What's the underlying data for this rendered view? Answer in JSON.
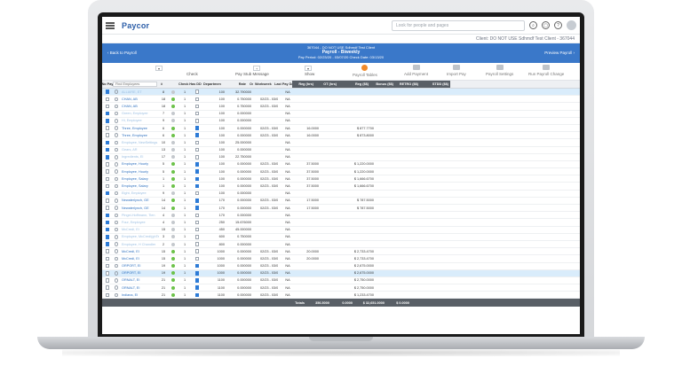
{
  "app": {
    "logo": "Paycor",
    "search_placeholder": "Look for people and pages"
  },
  "client_label": "Client: DO NOT USE Sdhmdf Test Client - 367044",
  "header": {
    "back_label": "Back to Payroll",
    "preview_label": "Preview Payroll",
    "line1": "367044 - DO NOT USE Sdhmdf Test Client",
    "line2": "Payroll - Biweekly",
    "line3": "Pay Period: 02/23/20 - 03/07/20    Check Date: 03/13/20"
  },
  "toolbar": {
    "check_label": "Check",
    "pay_stub_label": "Pay Stub Message",
    "show_label": "Show",
    "active_label": "Payroll Tables",
    "tools": [
      "Add Payment",
      "Import Pay",
      "Payroll Settings",
      "Run Payroll Change"
    ]
  },
  "columns": {
    "no_pay": "No Pay",
    "search": "Find Employees",
    "num": "#",
    "check": "Check",
    "has_dd": "Has DD",
    "department": "Department",
    "rate": "Rate",
    "ovr": "Ovrd",
    "workweek": "Workweek",
    "last_pay": "Last Pay Date",
    "reg_hrs": "Reg (hrs)",
    "ot_hrs": "OT (hrs)",
    "reg_amt": "Reg ($$)",
    "bonus": "Bonus ($$)",
    "retro": "RETRO ($$)",
    "std": "STDD ($$)"
  },
  "rows": [
    {
      "name": "ALLAIRE, ET",
      "num": "8",
      "check": "1",
      "dept": "100",
      "rate": "32.790000",
      "date": "",
      "lpd": "NA",
      "reg": "",
      "regamt": "",
      "noPay": true,
      "dot": "gray",
      "sel": true,
      "dis": true
    },
    {
      "name": "CHAN, AB",
      "num": "18",
      "check": "1",
      "dept": "100",
      "rate": "0.750000",
      "date": "02/23 - 03/01",
      "lpd": "NA",
      "reg": "",
      "regamt": "",
      "dot": "green"
    },
    {
      "name": "CHAN, AB",
      "num": "18",
      "check": "1",
      "dept": "100",
      "rate": "0.750000",
      "date": "02/23 - 03/08",
      "lpd": "NA",
      "reg": "",
      "regamt": "",
      "dot": "green"
    },
    {
      "name": "Green, Employee",
      "num": "7",
      "check": "1",
      "dept": "100",
      "rate": "0.000000",
      "date": "",
      "lpd": "NA",
      "reg": "",
      "regamt": "",
      "noPay": true,
      "dot": "gray",
      "dis": true
    },
    {
      "name": "Hi, Employee",
      "num": "9",
      "check": "1",
      "dept": "100",
      "rate": "0.000000",
      "date": "",
      "lpd": "NA",
      "reg": "",
      "regamt": "",
      "noPay": true,
      "dot": "gray",
      "dis": true
    },
    {
      "name": "Three, Employee",
      "num": "6",
      "check": "1",
      "dept": "100",
      "rate": "0.000000",
      "date": "02/23 - 03/01",
      "lpd": "NA",
      "reg": "16.0000",
      "regamt": "$ 877.7700",
      "dot": "green",
      "dd": true,
      "bar": true
    },
    {
      "name": "Three, Employee",
      "num": "6",
      "check": "1",
      "dept": "100",
      "rate": "0.000000",
      "date": "02/23 - 03/08",
      "lpd": "NA",
      "reg": "16.0000",
      "regamt": "$ 873.8000",
      "dot": "green",
      "dd": true,
      "bar": true
    },
    {
      "name": "Employee, NewSettings",
      "num": "10",
      "check": "1",
      "dept": "100",
      "rate": "25.000000",
      "date": "",
      "lpd": "NA",
      "reg": "",
      "regamt": "",
      "noPay": true,
      "dot": "gray",
      "dis": true
    },
    {
      "name": "Gears, AR",
      "num": "13",
      "check": "1",
      "dept": "100",
      "rate": "0.000000",
      "date": "",
      "lpd": "NA",
      "reg": "",
      "regamt": "",
      "noPay": true,
      "dot": "gray",
      "dis": true
    },
    {
      "name": "Ingredients, EI",
      "num": "17",
      "check": "1",
      "dept": "100",
      "rate": "22.750000",
      "date": "",
      "lpd": "NA",
      "reg": "",
      "regamt": "",
      "noPay": true,
      "dot": "gray",
      "dis": true
    },
    {
      "name": "Employee, Hourly",
      "num": "5",
      "check": "1",
      "dept": "100",
      "rate": "0.000000",
      "date": "02/23 - 03/01",
      "lpd": "NA",
      "reg": "37.5000",
      "regamt": "$ 1,220.0000",
      "dot": "green",
      "dd": true
    },
    {
      "name": "Employee, Hourly",
      "num": "5",
      "check": "1",
      "dept": "100",
      "rate": "0.000000",
      "date": "02/23 - 03/08",
      "lpd": "NA",
      "reg": "37.5000",
      "regamt": "$ 1,220.0000",
      "dot": "green",
      "dd": true
    },
    {
      "name": "Employee, Salary",
      "num": "1",
      "check": "1",
      "dept": "100",
      "rate": "0.000000",
      "date": "02/23 - 03/01",
      "lpd": "NA",
      "reg": "37.5000",
      "regamt": "$ 1,666.6700",
      "dot": "green",
      "dd": true
    },
    {
      "name": "Employee, Salary",
      "num": "1",
      "check": "1",
      "dept": "100",
      "rate": "0.000000",
      "date": "02/23 - 03/08",
      "lpd": "NA",
      "reg": "37.5000",
      "regamt": "$ 1,666.6700",
      "dot": "green",
      "dd": true
    },
    {
      "name": "Eight, Employee",
      "num": "9",
      "check": "1",
      "dept": "100",
      "rate": "0.000000",
      "date": "",
      "lpd": "NA",
      "reg": "",
      "regamt": "",
      "noPay": true,
      "dot": "gray",
      "dis": true
    },
    {
      "name": "Newaterlynch, GE",
      "num": "14",
      "check": "1",
      "dept": "170",
      "rate": "0.000000",
      "date": "02/23 - 03/01",
      "lpd": "NA",
      "reg": "17.5000",
      "regamt": "$ 787.5000",
      "dot": "green",
      "dd": true
    },
    {
      "name": "Newaterlynch, GE",
      "num": "14",
      "check": "1",
      "dept": "170",
      "rate": "0.000000",
      "date": "02/23 - 03/08",
      "lpd": "NA",
      "reg": "17.5000",
      "regamt": "$ 787.5000",
      "dot": "green",
      "dd": true
    },
    {
      "name": "Pingel-Hoffmann, Tien",
      "num": "4",
      "check": "1",
      "dept": "170",
      "rate": "0.000000",
      "date": "",
      "lpd": "NA",
      "reg": "",
      "regamt": "",
      "noPay": true,
      "dot": "gray",
      "dis": true,
      "bar": true
    },
    {
      "name": "Four, Employee",
      "num": "4",
      "check": "1",
      "dept": "250",
      "rate": "15.676000",
      "date": "",
      "lpd": "NA",
      "reg": "",
      "regamt": "",
      "noPay": true,
      "dot": "gray",
      "dis": true,
      "bar": true
    },
    {
      "name": "McCredi, EI",
      "num": "15",
      "check": "1",
      "dept": "450",
      "rate": "45.000000",
      "date": "",
      "lpd": "NA",
      "reg": "",
      "regamt": "",
      "noPay": true,
      "dot": "gray",
      "dis": true
    },
    {
      "name": "Employee, McCredi(ghTe)",
      "num": "3",
      "check": "1",
      "dept": "600",
      "rate": "0.750000",
      "date": "",
      "lpd": "NA",
      "reg": "",
      "regamt": "",
      "noPay": true,
      "dot": "gray",
      "dis": true
    },
    {
      "name": "Employee, H Chandler",
      "num": "2",
      "check": "1",
      "dept": "800",
      "rate": "0.000000",
      "date": "",
      "lpd": "NA",
      "reg": "",
      "regamt": "",
      "noPay": true,
      "dot": "gray",
      "dis": true
    },
    {
      "name": "McCredi, EI",
      "num": "15",
      "check": "1",
      "dept": "1000",
      "rate": "0.000000",
      "date": "02/23 - 03/01",
      "lpd": "NA",
      "reg": "20.0000",
      "regamt": "$ 2,733.4700",
      "dot": "green"
    },
    {
      "name": "McCredi, EI",
      "num": "15",
      "check": "1",
      "dept": "1000",
      "rate": "0.000000",
      "date": "02/23 - 03/08",
      "lpd": "NA",
      "reg": "20.0000",
      "regamt": "$ 2,733.4700",
      "dot": "green"
    },
    {
      "name": "ORPORT, EI",
      "num": "19",
      "check": "1",
      "dept": "1000",
      "rate": "0.000000",
      "date": "02/23 - 03/01",
      "lpd": "NA",
      "reg": "",
      "regamt": "$ 2,675.0000",
      "dot": "green",
      "dd": true
    },
    {
      "name": "ORPORT, EI",
      "num": "19",
      "check": "1",
      "dept": "1000",
      "rate": "0.000000",
      "date": "02/23 - 03/08",
      "lpd": "NA",
      "reg": "",
      "regamt": "$ 2,675.0000",
      "dot": "green",
      "dd": true,
      "sel": true
    },
    {
      "name": "ORNALT, EI",
      "num": "21",
      "check": "1",
      "dept": "1100",
      "rate": "0.000000",
      "date": "02/23 - 03/01",
      "lpd": "NA",
      "reg": "",
      "regamt": "$ 2,750.0000",
      "dot": "green",
      "dd": true
    },
    {
      "name": "ORNALT, EI",
      "num": "21",
      "check": "1",
      "dept": "1100",
      "rate": "0.000000",
      "date": "02/23 - 03/08",
      "lpd": "NA",
      "reg": "",
      "regamt": "$ 2,750.0000",
      "dot": "green",
      "dd": true
    },
    {
      "name": "Indiana, EI",
      "num": "21",
      "check": "1",
      "dept": "1100",
      "rate": "0.000000",
      "date": "02/23 - 03/01",
      "lpd": "NA",
      "reg": "",
      "regamt": "$ 1,233.4700",
      "dot": "green",
      "dd": true
    }
  ],
  "totals": {
    "label": "Totals",
    "reg": "356.5000",
    "ot": "0.0000",
    "regamt": "$ 32,651.0000",
    "bonus": "$ 0.0000"
  }
}
